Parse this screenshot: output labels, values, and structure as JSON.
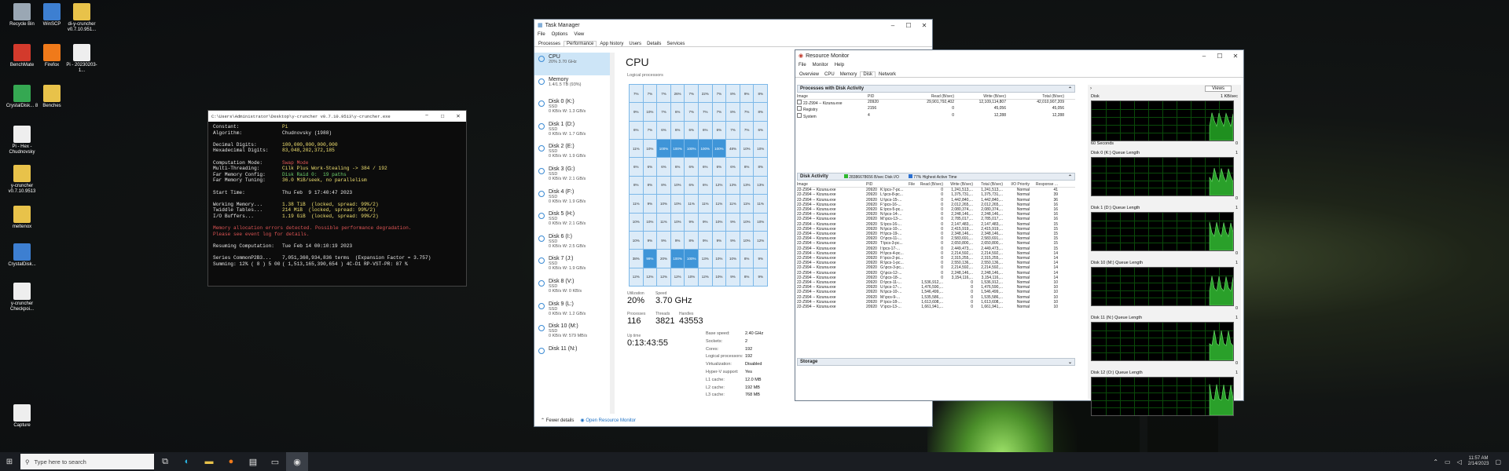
{
  "desktop": {
    "icons": [
      {
        "label": "Recycle Bin",
        "color": "#9aa7b4"
      },
      {
        "label": "WinSCP",
        "color": "#3d7fd1"
      },
      {
        "label": "di-y-cruncher v0.7.10.951...",
        "color": "#e8c24a"
      },
      {
        "label": "BenchMate",
        "color": "#d33a2c"
      },
      {
        "label": "Firefox",
        "color": "#f07a1a"
      },
      {
        "label": "Pi - 20230203-1...",
        "color": "#eeeeee"
      },
      {
        "label": "CrystalDisk... 8",
        "color": "#35a852"
      },
      {
        "label": "Benches",
        "color": "#e8c24a"
      },
      {
        "label": "Pi - Hex - Chudnovsky",
        "color": "#eeeeee"
      },
      {
        "label": "y-cruncher v0.7.10.9513",
        "color": "#e8c24a"
      },
      {
        "label": "meltenox",
        "color": "#e8c24a"
      },
      {
        "label": "CrystalDisk...",
        "color": "#3d7fd1"
      },
      {
        "label": "y-cruncher Checkpoi...",
        "color": "#eeeeee"
      },
      {
        "label": "Capture",
        "color": "#eeeeee"
      }
    ]
  },
  "console": {
    "title": "C:\\Users\\Administrator\\Desktop\\y-cruncher v0.7.10.9513\\y-cruncher.exe",
    "lines": [
      {
        "k": "Constant:",
        "v": "Pi",
        "c": "cy"
      },
      {
        "k": "Algorithm:",
        "v": "Chudnovsky (1988)",
        "c": "cw"
      },
      {
        "k": "",
        "v": "",
        "c": "cw"
      },
      {
        "k": "Decimal Digits:",
        "v": "100,000,000,000,000",
        "c": "cy"
      },
      {
        "k": "Hexadecimal Digits:",
        "v": "83,048,202,372,185",
        "c": "cy"
      },
      {
        "k": "",
        "v": "",
        "c": "cw"
      },
      {
        "k": "Computation Mode:",
        "v": "Swap Mode",
        "c": "cr"
      },
      {
        "k": "Multi-Threading:",
        "v": "Cilk Plus Work-Stealing -> 384 / 192",
        "c": "cy"
      },
      {
        "k": "Far Memory Config:",
        "v": "Disk Raid 0:  19 paths",
        "c": "cg"
      },
      {
        "k": "Far Memory Tuning:",
        "v": "36.0 MiB/seek, no parallelism",
        "c": "cy"
      },
      {
        "k": "",
        "v": "",
        "c": "cw"
      },
      {
        "k": "Start Time:",
        "v": "Thu Feb  9 17:40:47 2023",
        "c": "cw"
      },
      {
        "k": "",
        "v": "",
        "c": "cw"
      },
      {
        "k": "Working Memory...",
        "v": "1.38 TiB  (locked, spread: 99%/2)",
        "c": "cy"
      },
      {
        "k": "Twiddle Tables...",
        "v": "214 MiB  (locked, spread: 99%/2)",
        "c": "cy"
      },
      {
        "k": "I/O Buffers...",
        "v": "1.19 GiB  (locked, spread: 99%/2)",
        "c": "cy"
      },
      {
        "k": "",
        "v": "",
        "c": "cw"
      },
      {
        "k": "Memory allocation errors detected. Possible performance degradation.",
        "v": "",
        "c": "cr"
      },
      {
        "k": "Please see event log for details.",
        "v": "",
        "c": "cr"
      },
      {
        "k": "",
        "v": "",
        "c": "cw"
      },
      {
        "k": "Resuming Computation:",
        "v": "Tue Feb 14 00:10:19 2023",
        "c": "cw"
      },
      {
        "k": "",
        "v": "",
        "c": "cw"
      },
      {
        "k": "Series CommonP2B3...",
        "v": "7,051,360,934,836 terms  (Expansion Factor = 3.757)",
        "c": "cw"
      },
      {
        "k": "Summing: 12% ( 8 ) 5 00",
        "v": "( 1,513,165,390,654 ) 4C-D1 RP-VST-PR: 87 %",
        "c": "cw"
      }
    ]
  },
  "taskmgr": {
    "title": "Task Manager",
    "menu": [
      "File",
      "Options",
      "View"
    ],
    "tabs": [
      "Processes",
      "Performance",
      "App history",
      "Users",
      "Details",
      "Services"
    ],
    "side": [
      {
        "name": "CPU",
        "sub1": "20%  3.70 GHz",
        "sub2": ""
      },
      {
        "name": "Memory",
        "sub1": "1.4/1.5 TB (93%)",
        "sub2": ""
      },
      {
        "name": "Disk 0 (K:)",
        "sub1": "SSD",
        "sub2": "0 KB/s  W: 1.3 GB/s"
      },
      {
        "name": "Disk 1 (D:)",
        "sub1": "SSD",
        "sub2": "0 KB/s  W: 1.7 GB/s"
      },
      {
        "name": "Disk 2 (E:)",
        "sub1": "SSD",
        "sub2": "0 KB/s  W: 1.9 GB/s"
      },
      {
        "name": "Disk 3 (G:)",
        "sub1": "SSD",
        "sub2": "0 KB/s  W: 2.1 GB/s"
      },
      {
        "name": "Disk 4 (F:)",
        "sub1": "SSD",
        "sub2": "0 KB/s  W: 1.9 GB/s"
      },
      {
        "name": "Disk 5 (H:)",
        "sub1": "SSD",
        "sub2": "0 KB/s  W: 2.1 GB/s"
      },
      {
        "name": "Disk 6 (I:)",
        "sub1": "SSD",
        "sub2": "0 KB/s  W: 2.5 GB/s"
      },
      {
        "name": "Disk 7 (J:)",
        "sub1": "SSD",
        "sub2": "0 KB/s  W: 1.9 GB/s"
      },
      {
        "name": "Disk 8 (V:)",
        "sub1": "SSD",
        "sub2": "0 KB/s  W: 0 KB/s"
      },
      {
        "name": "Disk 9 (L:)",
        "sub1": "SSD",
        "sub2": "0 KB/s  W: 1.2 GB/s"
      },
      {
        "name": "Disk 10 (M:)",
        "sub1": "SSD",
        "sub2": "0 KB/s  W: 579 MB/s"
      },
      {
        "name": "Disk 11 (N:)",
        "sub1": "",
        "sub2": ""
      }
    ],
    "heading": "CPU",
    "grid_label": "Logical processors",
    "grid": [
      [
        "7%",
        "7%",
        "7%",
        "26%",
        "7%",
        "22%",
        "7%",
        "8%",
        "9%",
        "8%"
      ],
      [
        "9%",
        "10%",
        "7%",
        "6%",
        "7%",
        "7%",
        "7%",
        "8%",
        "7%",
        "8%"
      ],
      [
        "6%",
        "7%",
        "6%",
        "6%",
        "6%",
        "6%",
        "6%",
        "7%",
        "7%",
        "6%"
      ],
      [
        "11%",
        "10%",
        "100%",
        "100%",
        "100%",
        "100%",
        "100%",
        "48%",
        "10%",
        "10%"
      ],
      [
        "6%",
        "6%",
        "6%",
        "6%",
        "6%",
        "6%",
        "6%",
        "6%",
        "8%",
        "8%"
      ],
      [
        "8%",
        "8%",
        "8%",
        "10%",
        "6%",
        "6%",
        "12%",
        "13%",
        "13%",
        "13%"
      ],
      [
        "11%",
        "9%",
        "10%",
        "10%",
        "11%",
        "11%",
        "11%",
        "11%",
        "11%",
        "11%"
      ],
      [
        "10%",
        "10%",
        "11%",
        "10%",
        "9%",
        "9%",
        "10%",
        "9%",
        "10%",
        "10%"
      ],
      [
        "10%",
        "9%",
        "9%",
        "9%",
        "8%",
        "9%",
        "9%",
        "9%",
        "10%",
        "12%"
      ],
      [
        "38%",
        "99%",
        "20%",
        "100%",
        "100%",
        "13%",
        "10%",
        "10%",
        "8%",
        "9%"
      ],
      [
        "12%",
        "12%",
        "12%",
        "12%",
        "10%",
        "12%",
        "10%",
        "9%",
        "8%",
        "9%"
      ]
    ],
    "stats": {
      "utilization_label": "Utilization",
      "utilization": "20%",
      "speed_label": "Speed",
      "speed": "3.70 GHz",
      "processes_label": "Processes",
      "processes": "116",
      "threads_label": "Threads",
      "threads": "3821",
      "handles_label": "Handles",
      "handles": "43553",
      "uptime_label": "Up time",
      "uptime": "0:13:43:55"
    },
    "details": [
      {
        "k": "Base speed:",
        "v": "2.40 GHz"
      },
      {
        "k": "Sockets:",
        "v": "2"
      },
      {
        "k": "Cores:",
        "v": "192"
      },
      {
        "k": "Logical processors:",
        "v": "192"
      },
      {
        "k": "Virtualization:",
        "v": "Disabled"
      },
      {
        "k": "Hyper-V support:",
        "v": "Yes"
      },
      {
        "k": "L1 cache:",
        "v": "12.0 MB"
      },
      {
        "k": "L2 cache:",
        "v": "192 MB"
      },
      {
        "k": "L3 cache:",
        "v": "768 MB"
      }
    ],
    "fewer_details": "Fewer details",
    "open_resmon": "Open Resource Monitor"
  },
  "resmon": {
    "title": "Resource Monitor",
    "menu": [
      "File",
      "Monitor",
      "Help"
    ],
    "tabs": [
      "Overview",
      "CPU",
      "Memory",
      "Disk",
      "Network"
    ],
    "proc_section": "Processes with Disk Activity",
    "proc_headers": [
      "Image",
      "PID",
      "Read (B/sec)",
      "Write (B/sec)",
      "Total (B/sec)"
    ],
    "procs": [
      [
        "22-Z994 -- Kizuna.exe",
        "20920",
        "29,901,792,402",
        "12,109,114,807",
        "42,010,907,209"
      ],
      [
        "Registry",
        "2156",
        "0",
        "45,056",
        "45,056"
      ],
      [
        "System",
        "4",
        "0",
        "12,288",
        "12,288"
      ]
    ],
    "disk_section": "Disk Activity",
    "disk_io": "28386678656 B/sec Disk I/O",
    "active_time": "77% Highest Active Time",
    "disk_headers": [
      "Image",
      "PID",
      "File",
      "Read (B/sec)",
      "Write (B/sec)",
      "Total (B/sec)",
      "I/O Priority",
      "Response ..."
    ],
    "disk_rows": [
      [
        "22-Z994 -- Kizuna.exe",
        "20920",
        "K:\\pcs-7-pc...",
        "0",
        "1,241,513,...",
        "1,241,513,...",
        "Normal",
        "41"
      ],
      [
        "22-Z994 -- Kizuna.exe",
        "20920",
        "L:\\pcs-8-pc...",
        "0",
        "1,375,731,...",
        "1,375,731,...",
        "Normal",
        "39"
      ],
      [
        "22-Z994 -- Kizuna.exe",
        "20920",
        "U:\\pcs-15-...",
        "0",
        "1,442,840,...",
        "1,442,840,...",
        "Normal",
        "36"
      ],
      [
        "22-Z994 -- Kizuna.exe",
        "20920",
        "F:\\pcs-16-...",
        "0",
        "2,012,265,...",
        "2,012,265,...",
        "Normal",
        "16"
      ],
      [
        "22-Z994 -- Kizuna.exe",
        "20920",
        "E:\\pcs-5-pc...",
        "0",
        "2,080,374,...",
        "2,080,374,...",
        "Normal",
        "16"
      ],
      [
        "22-Z994 -- Kizuna.exe",
        "20920",
        "N:\\pcs-14-...",
        "0",
        "2,248,146,...",
        "2,248,146,...",
        "Normal",
        "16"
      ],
      [
        "22-Z994 -- Kizuna.exe",
        "20920",
        "M:\\pcs-13-...",
        "0",
        "2,785,017,...",
        "2,785,017,...",
        "Normal",
        "16"
      ],
      [
        "22-Z994 -- Kizuna.exe",
        "20920",
        "S:\\pcs-16-...",
        "0",
        "2,147,483,...",
        "2,147,483,...",
        "Normal",
        "15"
      ],
      [
        "22-Z994 -- Kizuna.exe",
        "20920",
        "N:\\pcs-10-...",
        "0",
        "2,415,919,...",
        "2,415,919,...",
        "Normal",
        "15"
      ],
      [
        "22-Z994 -- Kizuna.exe",
        "20920",
        "H:\\pcs-19-...",
        "0",
        "2,348,146,...",
        "2,348,146,...",
        "Normal",
        "15"
      ],
      [
        "22-Z994 -- Kizuna.exe",
        "20920",
        "O:\\pcs-11-...",
        "0",
        "2,583,691,...",
        "2,583,691,...",
        "Normal",
        "15"
      ],
      [
        "22-Z994 -- Kizuna.exe",
        "20920",
        "T:\\pcs-3-pc...",
        "0",
        "2,650,800,...",
        "2,650,800,...",
        "Normal",
        "15"
      ],
      [
        "22-Z994 -- Kizuna.exe",
        "20920",
        "I:\\pcs-17-...",
        "0",
        "2,449,473,...",
        "2,449,473,...",
        "Normal",
        "15"
      ],
      [
        "22-Z994 -- Kizuna.exe",
        "20920",
        "H:\\pcs-4-pc...",
        "0",
        "2,214,592,...",
        "2,214,592,...",
        "Normal",
        "14"
      ],
      [
        "22-Z994 -- Kizuna.exe",
        "20920",
        "F:\\pcs-2-pc...",
        "0",
        "2,315,255,...",
        "2,315,255,...",
        "Normal",
        "14"
      ],
      [
        "22-Z994 -- Kizuna.exe",
        "20920",
        "R:\\pcs-1-pc...",
        "0",
        "2,550,136,...",
        "2,550,136,...",
        "Normal",
        "14"
      ],
      [
        "22-Z994 -- Kizuna.exe",
        "20920",
        "G:\\pcs-3-pc...",
        "0",
        "2,214,592,...",
        "2,214,592,...",
        "Normal",
        "14"
      ],
      [
        "22-Z994 -- Kizuna.exe",
        "20920",
        "Q:\\pcs-12-...",
        "0",
        "2,248,146,...",
        "2,248,146,...",
        "Normal",
        "14"
      ],
      [
        "22-Z994 -- Kizuna.exe",
        "20920",
        "O:\\pcs-18-...",
        "0",
        "3,154,116,...",
        "3,154,116,...",
        "Normal",
        "14"
      ],
      [
        "22-Z994 -- Kizuna.exe",
        "20920",
        "D:\\pcs-11-...",
        "1,536,912,...",
        "0",
        "1,536,912,...",
        "Normal",
        "10"
      ],
      [
        "22-Z994 -- Kizuna.exe",
        "20920",
        "U:\\pcs-17-...",
        "1,476,590,...",
        "0",
        "1,476,590,...",
        "Normal",
        "10"
      ],
      [
        "22-Z994 -- Kizuna.exe",
        "20920",
        "N:\\pcs-10-...",
        "1,546,499,...",
        "0",
        "1,546,499,...",
        "Normal",
        "10"
      ],
      [
        "22-Z994 -- Kizuna.exe",
        "20920",
        "M:\\pcs-9-...",
        "1,535,586,...",
        "0",
        "1,535,586,...",
        "Normal",
        "10"
      ],
      [
        "22-Z994 -- Kizuna.exe",
        "20920",
        "P:\\pcs-18-...",
        "1,613,608,...",
        "0",
        "1,613,608,...",
        "Normal",
        "10"
      ],
      [
        "22-Z994 -- Kizuna.exe",
        "20920",
        "V:\\pcs-13-...",
        "1,661,941,...",
        "0",
        "1,661,941,...",
        "Normal",
        "10"
      ]
    ],
    "storage_section": "Storage",
    "views": "Views",
    "graphs": [
      {
        "label": "Disk",
        "right": "1 KB/sec",
        "foot": "60 Seconds",
        "foot_right": "0",
        "tall": true
      },
      {
        "label": "Disk 0 (K:) Queue Length",
        "right": "1",
        "foot": "",
        "foot_right": "0"
      },
      {
        "label": "Disk 1 (D:) Queue Length",
        "right": "1",
        "foot": "",
        "foot_right": "0"
      },
      {
        "label": "Disk 10 (M:) Queue Length",
        "right": "1",
        "foot": "",
        "foot_right": "0"
      },
      {
        "label": "Disk 11 (N:) Queue Length",
        "right": "1",
        "foot": "",
        "foot_right": "0"
      },
      {
        "label": "Disk 12 (O:) Queue Length",
        "right": "1",
        "foot": "",
        "foot_right": ""
      }
    ]
  },
  "taskbar": {
    "search_placeholder": "Type here to search",
    "time": "11:57 AM",
    "date": "2/14/2023"
  }
}
